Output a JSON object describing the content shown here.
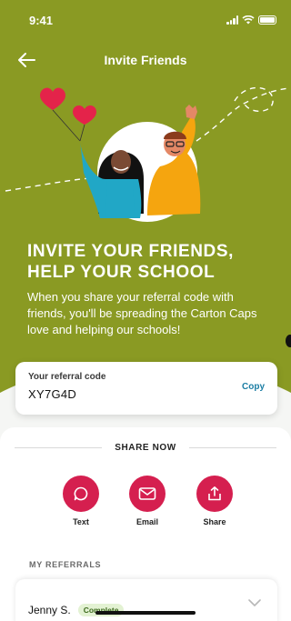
{
  "status_bar": {
    "time": "9:41"
  },
  "nav": {
    "title": "Invite Friends"
  },
  "hero": {
    "title_line1": "INVITE YOUR FRIENDS,",
    "title_line2": "HELP YOUR SCHOOL",
    "body": "When you share your referral code with friends, you'll be spreading the Carton Caps love and helping our schools!"
  },
  "referral_card": {
    "label": "Your referral code",
    "code": "XY7G4D",
    "copy_label": "Copy"
  },
  "share": {
    "header": "SHARE NOW",
    "actions": [
      {
        "label": "Text",
        "icon": "chat-bubble-icon"
      },
      {
        "label": "Email",
        "icon": "envelope-icon"
      },
      {
        "label": "Share",
        "icon": "share-icon"
      }
    ]
  },
  "referrals": {
    "header": "MY REFERRALS",
    "items": [
      {
        "name": "Jenny S.",
        "status": "Complete"
      }
    ]
  },
  "colors": {
    "hero_green": "#8a9a23",
    "accent_red": "#d51f4f",
    "link_blue": "#1c7ea4",
    "badge_green_bg": "#e3f2d3",
    "badge_green_text": "#3e6b1e"
  }
}
